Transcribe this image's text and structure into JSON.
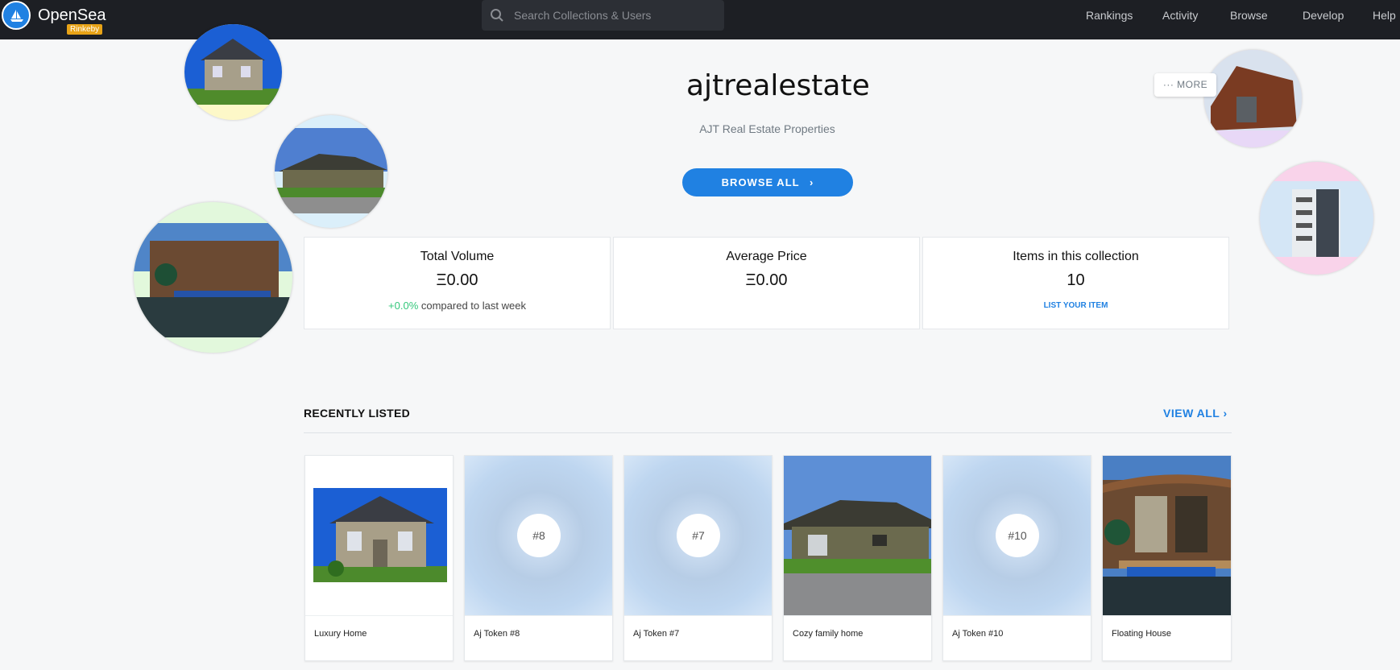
{
  "app": {
    "brand": "OpenSea",
    "network_badge": "Rinkeby",
    "logo_icon": "boat-logo-icon"
  },
  "search": {
    "placeholder": "Search Collections & Users",
    "icon": "search-icon"
  },
  "nav": {
    "items": [
      {
        "label": "Rankings"
      },
      {
        "label": "Activity"
      },
      {
        "label": "Browse"
      },
      {
        "label": "Develop"
      },
      {
        "label": "Help"
      }
    ]
  },
  "collection": {
    "title": "ajtrealestate",
    "subtitle": "AJT Real Estate Properties",
    "browse_label": "BROWSE ALL",
    "more_label": "··· MORE"
  },
  "stats": [
    {
      "label": "Total Volume",
      "value": "Ξ0.00",
      "change": "+0.0%",
      "change_suffix": " compared to last week"
    },
    {
      "label": "Average Price",
      "value": "Ξ0.00"
    },
    {
      "label": "Items in this collection",
      "value": "10",
      "link": "LIST YOUR ITEM"
    }
  ],
  "recently_listed": {
    "title": "RECENTLY LISTED",
    "view_all": "VIEW ALL",
    "items": [
      {
        "name": "Luxury Home",
        "media": "house-photo"
      },
      {
        "name": "Aj Token #8",
        "token": "#8"
      },
      {
        "name": "Aj Token #7",
        "token": "#7"
      },
      {
        "name": "Cozy family home",
        "media": "house-photo"
      },
      {
        "name": "Aj Token #10",
        "token": "#10"
      },
      {
        "name": "Floating House",
        "media": "houseboat-photo"
      }
    ]
  },
  "colors": {
    "accent": "#2081e2",
    "topbar": "#1d1f24",
    "positive": "#34c77b",
    "badge": "#e8a317"
  }
}
